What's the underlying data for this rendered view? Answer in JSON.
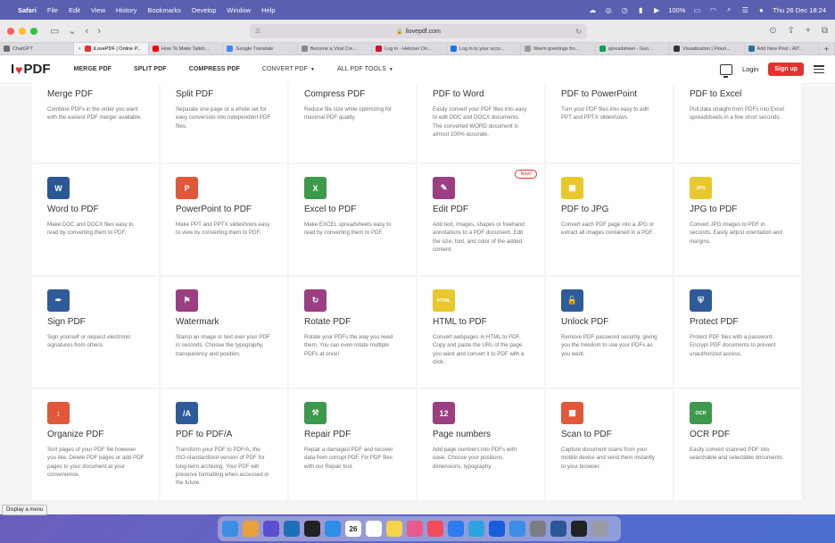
{
  "menubar": {
    "apple_glyph": "",
    "items": [
      "Safari",
      "File",
      "Edit",
      "View",
      "History",
      "Bookmarks",
      "Develop",
      "Window",
      "Help"
    ],
    "battery": "100%",
    "datetime": "Thu 26 Dec 18:24"
  },
  "browser": {
    "url": "ilovepdf.com",
    "tabs": [
      {
        "label": "ChatGPT",
        "color": "#6a6a6a"
      },
      {
        "label": "iLovePDF | Online P...",
        "color": "#e5322d",
        "active": true
      },
      {
        "label": "How To Make Talkin...",
        "color": "#ff0000"
      },
      {
        "label": "Google Translate",
        "color": "#4285f4"
      },
      {
        "label": "Become a Viral Cre...",
        "color": "#888888"
      },
      {
        "label": "Log in - Hetzner On...",
        "color": "#d50c2d"
      },
      {
        "label": "Log in to your acco...",
        "color": "#1a73e8"
      },
      {
        "label": "Warm greetings fro...",
        "color": "#999999"
      },
      {
        "label": "spreadsheet - Goo...",
        "color": "#0f9d58"
      },
      {
        "label": "Visualization | Flouri...",
        "color": "#333333"
      },
      {
        "label": "Add New Post ‹ AIT...",
        "color": "#21759b"
      }
    ]
  },
  "site": {
    "logo_left": "I",
    "logo_heart": "♥",
    "logo_right": "PDF",
    "nav": {
      "merge": "MERGE PDF",
      "split": "SPLIT PDF",
      "compress": "COMPRESS PDF",
      "convert": "CONVERT PDF",
      "all_tools": "ALL PDF TOOLS"
    },
    "login": "Login",
    "signup": "Sign up"
  },
  "tools": [
    {
      "title": "Merge PDF",
      "desc": "Combine PDFs in the order you want with the easiest PDF merger available."
    },
    {
      "title": "Split PDF",
      "desc": "Separate one page or a whole set for easy conversion into independent PDF files."
    },
    {
      "title": "Compress PDF",
      "desc": "Reduce file size while optimizing for maximal PDF quality."
    },
    {
      "title": "PDF to Word",
      "desc": "Easily convert your PDF files into easy to edit DOC and DOCX documents. The converted WORD document is almost 100% accurate."
    },
    {
      "title": "PDF to PowerPoint",
      "desc": "Turn your PDF files into easy to edit PPT and PPTX slideshows."
    },
    {
      "title": "PDF to Excel",
      "desc": "Pull data straight from PDFs into Excel spreadsheets in a few short seconds."
    },
    {
      "title": "Word to PDF",
      "desc": "Make DOC and DOCX files easy to read by converting them to PDF.",
      "icon": "word-icon",
      "color": "#2b5797",
      "glyph": "W"
    },
    {
      "title": "PowerPoint to PDF",
      "desc": "Make PPT and PPTX slideshows easy to view by converting them to PDF.",
      "icon": "powerpoint-icon",
      "color": "#e0573a",
      "glyph": "P"
    },
    {
      "title": "Excel to PDF",
      "desc": "Make EXCEL spreadsheets easy to read by converting them to PDF.",
      "icon": "excel-icon",
      "color": "#3c9a4c",
      "glyph": "X"
    },
    {
      "title": "Edit PDF",
      "desc": "Add text, images, shapes or freehand annotations to a PDF document. Edit the size, font, and color of the added content.",
      "icon": "edit-icon",
      "color": "#9c3f82",
      "glyph": "✎",
      "badge": "New!"
    },
    {
      "title": "PDF to JPG",
      "desc": "Convert each PDF page into a JPG or extract all images contained in a PDF.",
      "icon": "pdf-to-jpg-icon",
      "color": "#e8c82c",
      "glyph": "▣"
    },
    {
      "title": "JPG to PDF",
      "desc": "Convert JPG images to PDF in seconds. Easily adjust orientation and margins.",
      "icon": "jpg-to-pdf-icon",
      "color": "#e8c82c",
      "glyph": "JPG"
    },
    {
      "title": "Sign PDF",
      "desc": "Sign yourself or request electronic signatures from others.",
      "icon": "sign-icon",
      "color": "#2e5c9a",
      "glyph": "✒"
    },
    {
      "title": "Watermark",
      "desc": "Stamp an image or text over your PDF in seconds. Choose the typography, transparency and position.",
      "icon": "watermark-icon",
      "color": "#9c3f82",
      "glyph": "⚑"
    },
    {
      "title": "Rotate PDF",
      "desc": "Rotate your PDFs the way you need them. You can even rotate multiple PDFs at once!",
      "icon": "rotate-icon",
      "color": "#9c3f82",
      "glyph": "↻"
    },
    {
      "title": "HTML to PDF",
      "desc": "Convert webpages in HTML to PDF. Copy and paste the URL of the page you want and convert it to PDF with a click.",
      "icon": "html-icon",
      "color": "#e8c82c",
      "glyph": "HTML"
    },
    {
      "title": "Unlock PDF",
      "desc": "Remove PDF password security, giving you the freedom to use your PDFs as you want.",
      "icon": "unlock-icon",
      "color": "#2e5c9a",
      "glyph": "🔓"
    },
    {
      "title": "Protect PDF",
      "desc": "Protect PDF files with a password. Encrypt PDF documents to prevent unauthorized access.",
      "icon": "shield-icon",
      "color": "#2e5c9a",
      "glyph": "⛨"
    },
    {
      "title": "Organize PDF",
      "desc": "Sort pages of your PDF file however you like. Delete PDF pages or add PDF pages to your document at your convenience.",
      "icon": "organize-icon",
      "color": "#e0573a",
      "glyph": "↕"
    },
    {
      "title": "PDF to PDF/A",
      "desc": "Transform your PDF to PDF/A, the ISO-standardized version of PDF for long-term archiving. Your PDF will preserve formatting when accessed in the future.",
      "icon": "pdfa-icon",
      "color": "#2e5c9a",
      "glyph": "/A"
    },
    {
      "title": "Repair PDF",
      "desc": "Repair a damaged PDF and recover data from corrupt PDF. Fix PDF files with our Repair tool.",
      "icon": "repair-icon",
      "color": "#3c9a4c",
      "glyph": "⚒"
    },
    {
      "title": "Page numbers",
      "desc": "Add page numbers into PDFs with ease. Choose your positions, dimensions, typography.",
      "icon": "page-numbers-icon",
      "color": "#9c3f82",
      "glyph": "12"
    },
    {
      "title": "Scan to PDF",
      "desc": "Capture document scans from your mobile device and send them instantly to your browser.",
      "icon": "scan-icon",
      "color": "#e0573a",
      "glyph": "▦"
    },
    {
      "title": "OCR PDF",
      "desc": "Easily convert scanned PDF into searchable and selectable documents.",
      "icon": "ocr-icon",
      "color": "#3c9a4c",
      "glyph": "OCR"
    }
  ],
  "tooltip": "Display a menu",
  "dock": {
    "calendar_day": "26",
    "apps": [
      {
        "icon": "finder-icon",
        "color": "#3a8ee6"
      },
      {
        "icon": "launchpad-icon",
        "color": "#e9a23b"
      },
      {
        "icon": "shortcuts-icon",
        "color": "#5b4fd1"
      },
      {
        "icon": "vscode-icon",
        "color": "#1f6fb8"
      },
      {
        "icon": "chatgpt-icon",
        "color": "#222222"
      },
      {
        "icon": "safari-icon",
        "color": "#2f8fe6"
      },
      {
        "icon": "calendar-icon",
        "color": "#ffffff"
      },
      {
        "icon": "reminders-icon",
        "color": "#ffffff"
      },
      {
        "icon": "notes-icon",
        "color": "#f5d44a"
      },
      {
        "icon": "photos-icon",
        "color": "#e85a8a"
      },
      {
        "icon": "music-icon",
        "color": "#f24b5b"
      },
      {
        "icon": "appstore-icon",
        "color": "#2d7df0"
      },
      {
        "icon": "telegram-icon",
        "color": "#2aa3e0"
      },
      {
        "icon": "bitwarden-icon",
        "color": "#175ddc"
      },
      {
        "icon": "mail-icon",
        "color": "#3a8ee6"
      },
      {
        "icon": "settings-icon",
        "color": "#7d7d85"
      },
      {
        "icon": "word-app-icon",
        "color": "#2b5797"
      },
      {
        "icon": "terminal-icon",
        "color": "#222222"
      },
      {
        "icon": "trash-icon",
        "color": "#9a9aa4"
      }
    ]
  }
}
